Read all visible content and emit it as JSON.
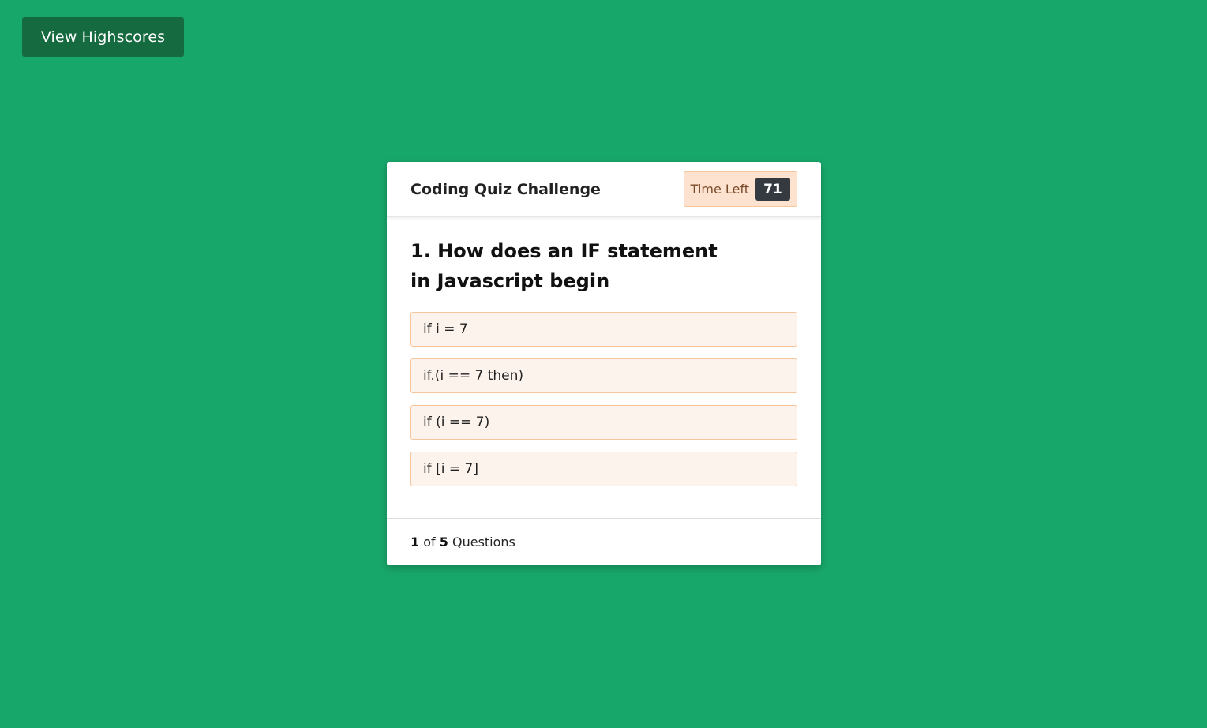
{
  "nav": {
    "highscores_label": "View Highscores"
  },
  "quiz": {
    "title": "Coding Quiz Challenge",
    "timer": {
      "label": "Time Left",
      "value": "71"
    },
    "question": "1. How does an IF statement in Javascript begin",
    "answers": [
      "if i = 7",
      "if.(i == 7 then)",
      "if (i == 7)",
      "if [i = 7]"
    ],
    "footer": {
      "current": "1",
      "of_word": "of",
      "total": "5",
      "suffix": "Questions"
    }
  },
  "colors": {
    "background": "#18a76a",
    "button": "#156a3f",
    "answer_bg": "#fdf3ed",
    "answer_border": "#f5c69e",
    "timer_bg": "#fde3cf",
    "timer_value_bg": "#343a40"
  }
}
